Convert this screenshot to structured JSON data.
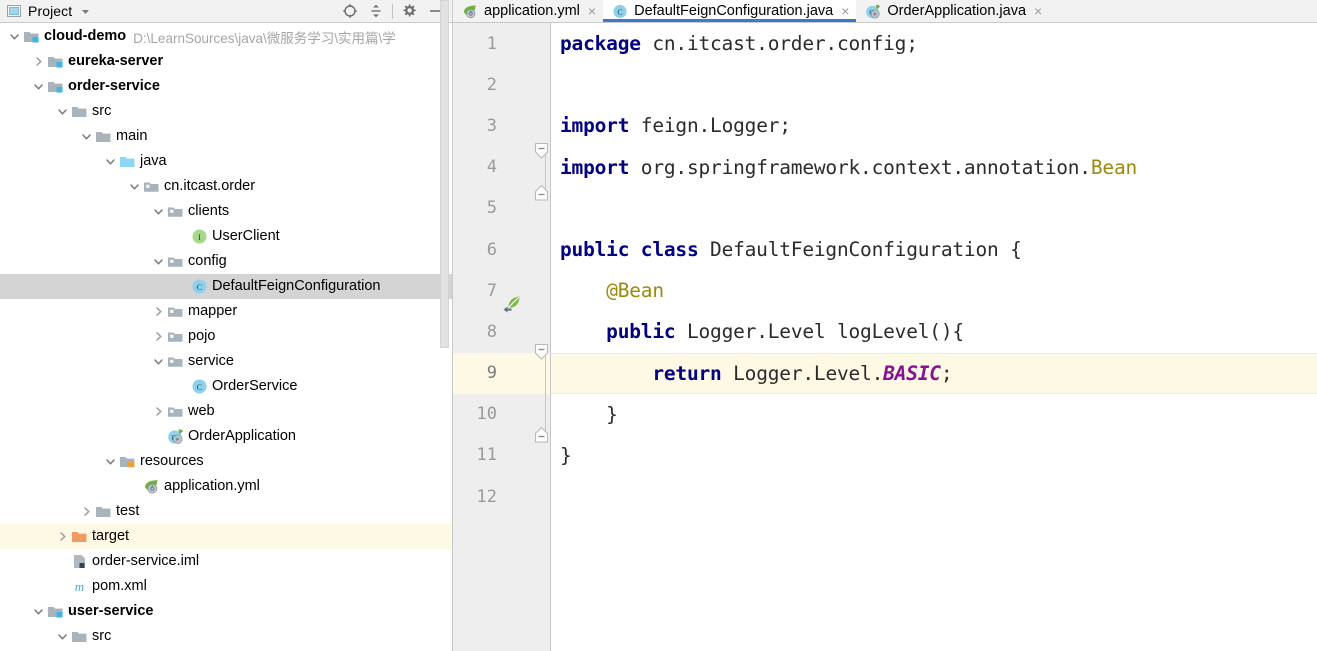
{
  "project_panel": {
    "header": {
      "title": "Project",
      "dropdown_icon": "chevron-down-icon",
      "window_icon": "project-window-icon",
      "icons": [
        {
          "name": "locate-icon",
          "glyph": "target"
        },
        {
          "name": "collapse-all-icon",
          "glyph": "collapse"
        },
        {
          "name": "gear-icon",
          "glyph": "gear"
        },
        {
          "name": "hide-icon",
          "glyph": "minus"
        }
      ]
    },
    "tree": [
      {
        "label": "cloud-demo",
        "sub": "D:\\LearnSources\\java\\微服务学习\\实用篇\\学",
        "depth": 0,
        "arrow": "down",
        "icon": "module-folder-icon",
        "bold": true,
        "state": "normal"
      },
      {
        "label": "eureka-server",
        "sub": "",
        "depth": 1,
        "arrow": "right",
        "icon": "module-folder-icon",
        "bold": true,
        "state": "normal"
      },
      {
        "label": "order-service",
        "sub": "",
        "depth": 1,
        "arrow": "down",
        "icon": "module-folder-icon",
        "bold": true,
        "state": "normal"
      },
      {
        "label": "src",
        "sub": "",
        "depth": 2,
        "arrow": "down",
        "icon": "folder-icon",
        "bold": false,
        "state": "normal"
      },
      {
        "label": "main",
        "sub": "",
        "depth": 3,
        "arrow": "down",
        "icon": "folder-icon",
        "bold": false,
        "state": "normal"
      },
      {
        "label": "java",
        "sub": "",
        "depth": 4,
        "arrow": "down",
        "icon": "source-folder-icon",
        "bold": false,
        "state": "normal"
      },
      {
        "label": "cn.itcast.order",
        "sub": "",
        "depth": 5,
        "arrow": "down",
        "icon": "package-icon",
        "bold": false,
        "state": "normal"
      },
      {
        "label": "clients",
        "sub": "",
        "depth": 6,
        "arrow": "down",
        "icon": "package-icon",
        "bold": false,
        "state": "normal"
      },
      {
        "label": "UserClient",
        "sub": "",
        "depth": 7,
        "arrow": "none",
        "icon": "interface-icon",
        "bold": false,
        "state": "normal"
      },
      {
        "label": "config",
        "sub": "",
        "depth": 6,
        "arrow": "down",
        "icon": "package-icon",
        "bold": false,
        "state": "normal"
      },
      {
        "label": "DefaultFeignConfiguration",
        "sub": "",
        "depth": 7,
        "arrow": "none",
        "icon": "class-icon",
        "bold": false,
        "state": "selected"
      },
      {
        "label": "mapper",
        "sub": "",
        "depth": 6,
        "arrow": "right",
        "icon": "package-icon",
        "bold": false,
        "state": "normal"
      },
      {
        "label": "pojo",
        "sub": "",
        "depth": 6,
        "arrow": "right",
        "icon": "package-icon",
        "bold": false,
        "state": "normal"
      },
      {
        "label": "service",
        "sub": "",
        "depth": 6,
        "arrow": "down",
        "icon": "package-icon",
        "bold": false,
        "state": "normal"
      },
      {
        "label": "OrderService",
        "sub": "",
        "depth": 7,
        "arrow": "none",
        "icon": "class-icon",
        "bold": false,
        "state": "normal"
      },
      {
        "label": "web",
        "sub": "",
        "depth": 6,
        "arrow": "right",
        "icon": "package-icon",
        "bold": false,
        "state": "normal"
      },
      {
        "label": "OrderApplication",
        "sub": "",
        "depth": 6,
        "arrow": "none",
        "icon": "spring-class-icon",
        "bold": false,
        "state": "normal"
      },
      {
        "label": "resources",
        "sub": "",
        "depth": 4,
        "arrow": "down",
        "icon": "resources-folder-icon",
        "bold": false,
        "state": "normal"
      },
      {
        "label": "application.yml",
        "sub": "",
        "depth": 5,
        "arrow": "none",
        "icon": "spring-yml-icon",
        "bold": false,
        "state": "normal"
      },
      {
        "label": "test",
        "sub": "",
        "depth": 3,
        "arrow": "right",
        "icon": "folder-icon",
        "bold": false,
        "state": "normal"
      },
      {
        "label": "target",
        "sub": "",
        "depth": 2,
        "arrow": "right",
        "icon": "excluded-folder-icon",
        "bold": false,
        "state": "highlighted"
      },
      {
        "label": "order-service.iml",
        "sub": "",
        "depth": 2,
        "arrow": "none",
        "icon": "iml-icon",
        "bold": false,
        "state": "normal"
      },
      {
        "label": "pom.xml",
        "sub": "",
        "depth": 2,
        "arrow": "none",
        "icon": "maven-icon",
        "bold": false,
        "state": "normal"
      },
      {
        "label": "user-service",
        "sub": "",
        "depth": 1,
        "arrow": "down",
        "icon": "module-folder-icon",
        "bold": true,
        "state": "normal"
      },
      {
        "label": "src",
        "sub": "",
        "depth": 2,
        "arrow": "down",
        "icon": "folder-icon",
        "bold": false,
        "state": "normal"
      }
    ],
    "scrollbar": {
      "name": "project-tree-scrollbar"
    }
  },
  "editor": {
    "tabs": [
      {
        "label": "application.yml",
        "icon": "spring-yml-icon",
        "active": false,
        "close": "×"
      },
      {
        "label": "DefaultFeignConfiguration.java",
        "icon": "class-icon",
        "active": true,
        "close": "×"
      },
      {
        "label": "OrderApplication.java",
        "icon": "spring-class-icon",
        "active": false,
        "close": "×"
      }
    ],
    "line_numbers": [
      "1",
      "2",
      "3",
      "4",
      "5",
      "6",
      "7",
      "8",
      "9",
      "10",
      "11",
      "12"
    ],
    "current_line": 9,
    "gutter": {
      "bean_icon_line": 7,
      "bean_icon_name": "spring-bean-gutter-icon",
      "fold_markers": [
        {
          "line": 3,
          "type": "start"
        },
        {
          "line": 4,
          "type": "end"
        },
        {
          "line": 8,
          "type": "start"
        },
        {
          "line": 10,
          "type": "end"
        }
      ]
    },
    "code_lines": [
      {
        "n": 1,
        "tokens": [
          {
            "t": "package",
            "c": "kw"
          },
          {
            "t": " cn.itcast.order.config;",
            "c": "plain"
          }
        ]
      },
      {
        "n": 2,
        "tokens": []
      },
      {
        "n": 3,
        "tokens": [
          {
            "t": "import",
            "c": "kw"
          },
          {
            "t": " feign.Logger;",
            "c": "plain"
          }
        ]
      },
      {
        "n": 4,
        "tokens": [
          {
            "t": "import",
            "c": "kw"
          },
          {
            "t": " org.springframework.context.annotation.",
            "c": "plain"
          },
          {
            "t": "Bean",
            "c": "anno"
          }
        ]
      },
      {
        "n": 5,
        "tokens": []
      },
      {
        "n": 6,
        "tokens": [
          {
            "t": "public class",
            "c": "kw"
          },
          {
            "t": " DefaultFeignConfiguration {",
            "c": "plain"
          }
        ]
      },
      {
        "n": 7,
        "tokens": [
          {
            "t": "    ",
            "c": "plain"
          },
          {
            "t": "@Bean",
            "c": "anno"
          }
        ]
      },
      {
        "n": 8,
        "tokens": [
          {
            "t": "    ",
            "c": "plain"
          },
          {
            "t": "public",
            "c": "kw"
          },
          {
            "t": " Logger.Level logLevel(){",
            "c": "plain"
          }
        ]
      },
      {
        "n": 9,
        "tokens": [
          {
            "t": "        ",
            "c": "plain"
          },
          {
            "t": "return",
            "c": "kw"
          },
          {
            "t": " Logger.Level.",
            "c": "plain"
          },
          {
            "t": "BASIC",
            "c": "stat"
          },
          {
            "t": ";",
            "c": "plain"
          }
        ]
      },
      {
        "n": 10,
        "tokens": [
          {
            "t": "    }",
            "c": "plain"
          }
        ]
      },
      {
        "n": 11,
        "tokens": [
          {
            "t": "}",
            "c": "plain"
          }
        ]
      },
      {
        "n": 12,
        "tokens": []
      }
    ]
  },
  "colors": {
    "accent": "#3a7bc8",
    "selection": "#d4d4d4",
    "current_line": "#fdf9e4",
    "keyword": "#000080",
    "annotation": "#9e880d",
    "static_field": "#871094",
    "gutter_bg": "#eeeeee",
    "header_bg": "#f2f2f2"
  }
}
